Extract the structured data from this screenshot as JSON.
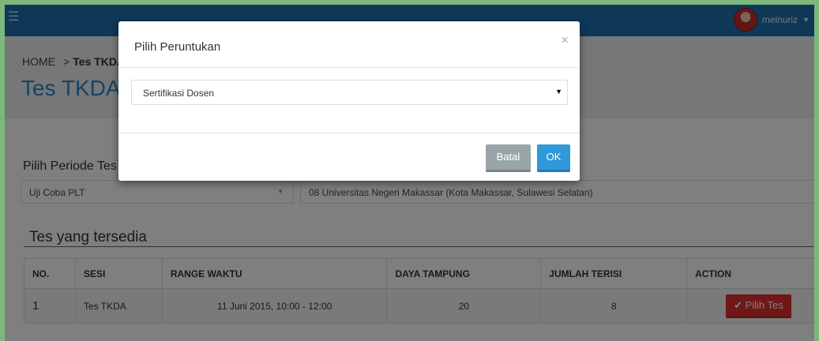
{
  "topbar": {
    "username": "meinuriz"
  },
  "breadcrumb": {
    "home": "HOME",
    "separator": ">",
    "current": "Tes TKDA"
  },
  "page": {
    "title": "Tes TKDA"
  },
  "period": {
    "label": "Pilih Periode Tes",
    "selected": "Uji Coba PLT",
    "university": "08 Universitas Negeri Makassar (Kota Makassar, Sulawesi Selatan)"
  },
  "tests": {
    "title": "Tes yang tersedia",
    "headers": [
      "NO.",
      "SESI",
      "RANGE WAKTU",
      "DAYA TAMPUNG",
      "JUMLAH TERISI",
      "ACTION"
    ],
    "rows": [
      {
        "no": "1",
        "sesi": "Tes TKDA",
        "range": "11 Juni 2015, 10:00 - 12:00",
        "daya": "20",
        "terisi": "8",
        "action": "Pilih Tes"
      }
    ]
  },
  "modal": {
    "title": "Pilih Peruntukan",
    "close": "×",
    "selected": "Sertifikasi Dosen",
    "cancel_label": "Batal",
    "ok_label": "OK"
  },
  "icons": {
    "menu": "hamburger-icon",
    "check": "check-icon",
    "close": "close-icon",
    "caret": "caret-down-icon"
  },
  "colors": {
    "topbar": "#1f6fb0",
    "title": "#2a88c8",
    "danger": "#e0302f",
    "primary": "#2f98d9",
    "muted": "#9aa5aa"
  }
}
